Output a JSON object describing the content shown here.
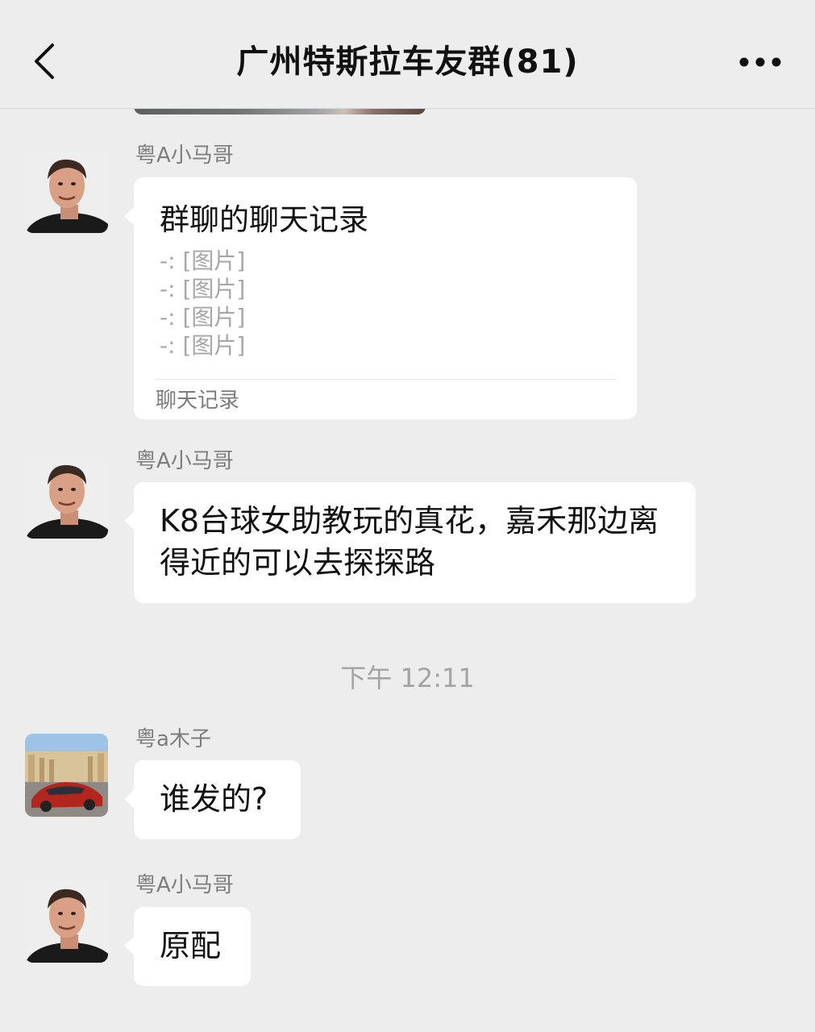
{
  "header": {
    "back_icon": "chevron-left-icon",
    "title": "广州特斯拉车友群(81)",
    "more_icon": "more-horizontal-icon"
  },
  "messages": [
    {
      "sender": "粤A小马哥",
      "type": "chat-record",
      "record": {
        "title": "群聊的聊天记录",
        "lines": [
          "-: [图片]",
          "-: [图片]",
          "-: [图片]",
          "-: [图片]"
        ],
        "footer": "聊天记录"
      }
    },
    {
      "sender": "粤A小马哥",
      "type": "text",
      "text": "K8台球女助教玩的真花，嘉禾那边离得近的可以去探探路"
    },
    {
      "sender": "粤a木子",
      "type": "text",
      "text": "谁发的?"
    },
    {
      "sender": "粤A小马哥",
      "type": "text",
      "text": "原配"
    }
  ],
  "timestamp": "下午 12:11",
  "colors": {
    "background": "#ededed",
    "bubble": "#ffffff",
    "sender_text": "#7d7d7d",
    "muted_text": "#a7a7a7",
    "title_text": "#111111"
  }
}
